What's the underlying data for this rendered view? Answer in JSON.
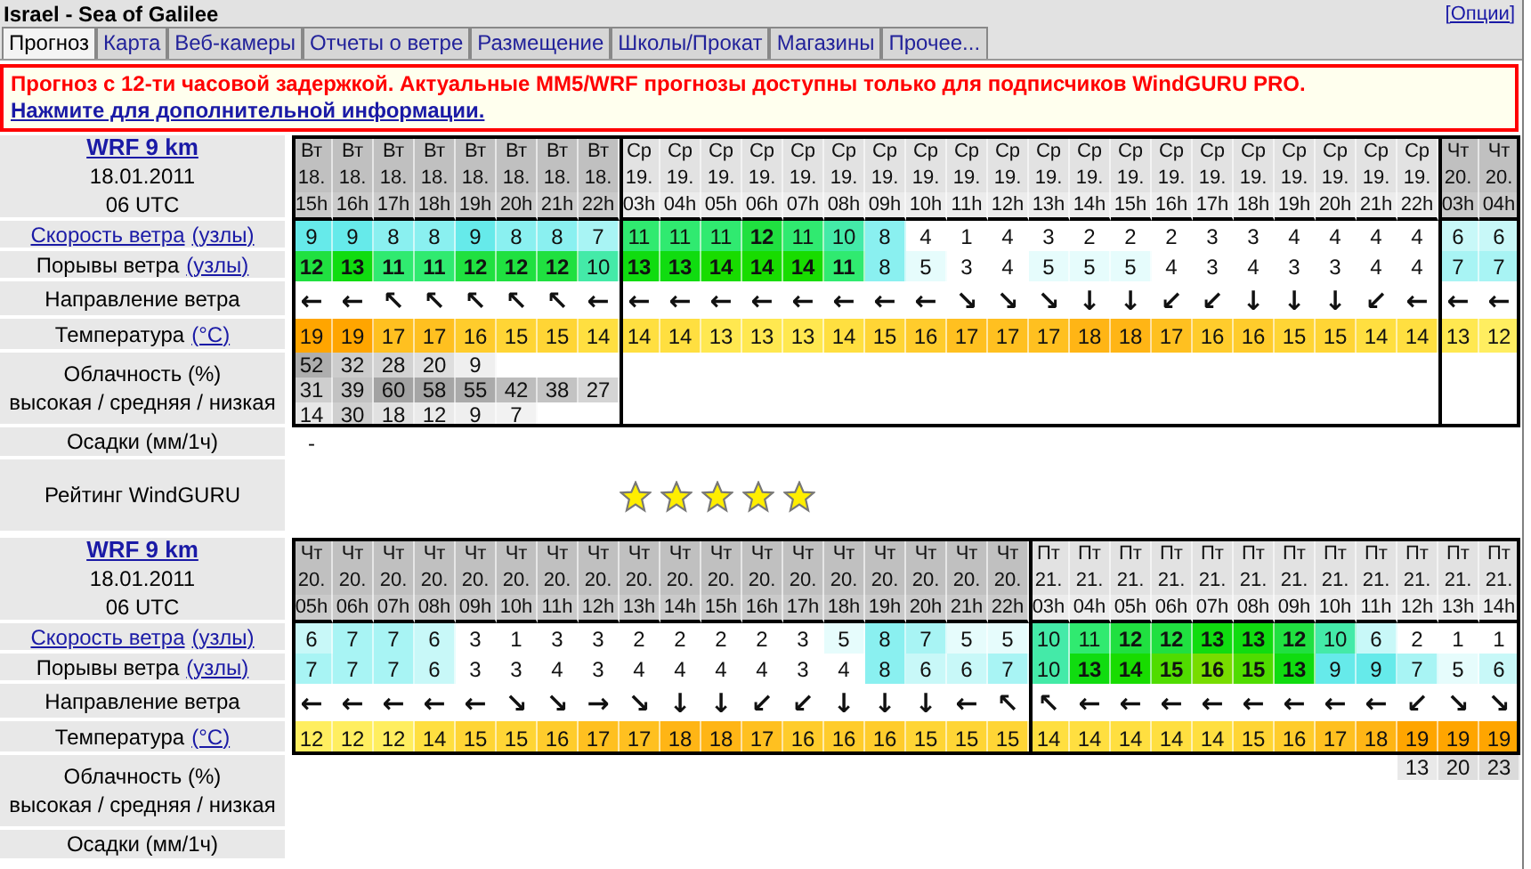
{
  "window": {
    "title": "Israel - Sea of Galilee",
    "options_link": "[Опции]"
  },
  "tabs": [
    {
      "label": "Прогноз",
      "selected": true
    },
    {
      "label": "Карта",
      "selected": false
    },
    {
      "label": "Веб-камеры",
      "selected": false
    },
    {
      "label": "Отчеты о ветре",
      "selected": false
    },
    {
      "label": "Размещение",
      "selected": false
    },
    {
      "label": "Школы/Прокат",
      "selected": false
    },
    {
      "label": "Магазины",
      "selected": false
    },
    {
      "label": "Прочее...",
      "selected": false
    }
  ],
  "notice": {
    "text": "Прогноз с 12-ти часовой задержкой. Актуальные MM5/WRF прогнозы доступны только для подписчиков WindGURU PRO.",
    "link": "Нажмите для дополнительной информации."
  },
  "forecasts": [
    {
      "model": "WRF 9 km",
      "date": "18.01.2011",
      "time": "06 UTC",
      "clouds_boxed": true,
      "labels": {
        "wind": "Скорость ветра",
        "wind_unit": "(узлы)",
        "gust": "Порывы ветра",
        "gust_unit": "(узлы)",
        "direction": "Направление ветра",
        "temp": "Температура",
        "temp_unit": "(°C)",
        "cloud": "Облачность (%)",
        "cloud_layers": "высокая / средняя / низкая",
        "precip": "Осадки (мм/1ч)",
        "rating": "Рейтинг WindGURU"
      },
      "days": [
        {
          "columns": [
            {
              "day": "Вт",
              "date": "18.",
              "hour": "15h",
              "wind": "9",
              "gust": "12",
              "dir": "←",
              "temp": "19",
              "cloud": {
                "high": "52",
                "mid": "31",
                "low": "14"
              }
            },
            {
              "day": "Вт",
              "date": "18.",
              "hour": "16h",
              "wind": "9",
              "gust": "13",
              "dir": "←",
              "temp": "19",
              "cloud": {
                "high": "32",
                "mid": "39",
                "low": "30"
              }
            },
            {
              "day": "Вт",
              "date": "18.",
              "hour": "17h",
              "wind": "8",
              "gust": "11",
              "dir": "↖",
              "temp": "17",
              "cloud": {
                "high": "28",
                "mid": "60",
                "low": "18"
              }
            },
            {
              "day": "Вт",
              "date": "18.",
              "hour": "18h",
              "wind": "8",
              "gust": "11",
              "dir": "↖",
              "temp": "17",
              "cloud": {
                "high": "20",
                "mid": "58",
                "low": "12"
              }
            },
            {
              "day": "Вт",
              "date": "18.",
              "hour": "19h",
              "wind": "9",
              "gust": "12",
              "dir": "↖",
              "temp": "16",
              "cloud": {
                "high": "9",
                "mid": "55",
                "low": "9"
              }
            },
            {
              "day": "Вт",
              "date": "18.",
              "hour": "20h",
              "wind": "8",
              "gust": "12",
              "dir": "↖",
              "temp": "15",
              "cloud": {
                "mid": "42",
                "low": "7"
              }
            },
            {
              "day": "Вт",
              "date": "18.",
              "hour": "21h",
              "wind": "8",
              "gust": "12",
              "dir": "↖",
              "temp": "15",
              "cloud": {
                "mid": "38"
              }
            },
            {
              "day": "Вт",
              "date": "18.",
              "hour": "22h",
              "wind": "7",
              "gust": "10",
              "dir": "←",
              "temp": "14",
              "cloud": {
                "mid": "27"
              }
            }
          ]
        },
        {
          "columns": [
            {
              "day": "Ср",
              "date": "19.",
              "hour": "03h",
              "wind": "11",
              "gust": "13",
              "dir": "←",
              "temp": "14"
            },
            {
              "day": "Ср",
              "date": "19.",
              "hour": "04h",
              "wind": "11",
              "gust": "13",
              "dir": "←",
              "temp": "14"
            },
            {
              "day": "Ср",
              "date": "19.",
              "hour": "05h",
              "wind": "11",
              "gust": "14",
              "dir": "←",
              "temp": "13"
            },
            {
              "day": "Ср",
              "date": "19.",
              "hour": "06h",
              "wind": "12",
              "gust": "14",
              "dir": "←",
              "temp": "13"
            },
            {
              "day": "Ср",
              "date": "19.",
              "hour": "07h",
              "wind": "11",
              "gust": "14",
              "dir": "←",
              "temp": "13"
            },
            {
              "day": "Ср",
              "date": "19.",
              "hour": "08h",
              "wind": "10",
              "gust": "11",
              "dir": "←",
              "temp": "14"
            },
            {
              "day": "Ср",
              "date": "19.",
              "hour": "09h",
              "wind": "8",
              "gust": "8",
              "dir": "←",
              "temp": "15"
            },
            {
              "day": "Ср",
              "date": "19.",
              "hour": "10h",
              "wind": "4",
              "gust": "5",
              "dir": "←",
              "temp": "16"
            },
            {
              "day": "Ср",
              "date": "19.",
              "hour": "11h",
              "wind": "1",
              "gust": "3",
              "dir": "↘",
              "temp": "17"
            },
            {
              "day": "Ср",
              "date": "19.",
              "hour": "12h",
              "wind": "4",
              "gust": "4",
              "dir": "↘",
              "temp": "17"
            },
            {
              "day": "Ср",
              "date": "19.",
              "hour": "13h",
              "wind": "3",
              "gust": "5",
              "dir": "↘",
              "temp": "17"
            },
            {
              "day": "Ср",
              "date": "19.",
              "hour": "14h",
              "wind": "2",
              "gust": "5",
              "dir": "↓",
              "temp": "18"
            },
            {
              "day": "Ср",
              "date": "19.",
              "hour": "15h",
              "wind": "2",
              "gust": "5",
              "dir": "↓",
              "temp": "18"
            },
            {
              "day": "Ср",
              "date": "19.",
              "hour": "16h",
              "wind": "2",
              "gust": "4",
              "dir": "↙",
              "temp": "17"
            },
            {
              "day": "Ср",
              "date": "19.",
              "hour": "17h",
              "wind": "3",
              "gust": "3",
              "dir": "↙",
              "temp": "16"
            },
            {
              "day": "Ср",
              "date": "19.",
              "hour": "18h",
              "wind": "3",
              "gust": "4",
              "dir": "↓",
              "temp": "16"
            },
            {
              "day": "Ср",
              "date": "19.",
              "hour": "19h",
              "wind": "4",
              "gust": "3",
              "dir": "↓",
              "temp": "15"
            },
            {
              "day": "Ср",
              "date": "19.",
              "hour": "20h",
              "wind": "4",
              "gust": "3",
              "dir": "↓",
              "temp": "15"
            },
            {
              "day": "Ср",
              "date": "19.",
              "hour": "21h",
              "wind": "4",
              "gust": "4",
              "dir": "↙",
              "temp": "14"
            },
            {
              "day": "Ср",
              "date": "19.",
              "hour": "22h",
              "wind": "4",
              "gust": "4",
              "dir": "←",
              "temp": "14"
            }
          ]
        },
        {
          "columns": [
            {
              "day": "Чт",
              "date": "20.",
              "hour": "03h",
              "wind": "6",
              "gust": "7",
              "dir": "←",
              "temp": "13"
            },
            {
              "day": "Чт",
              "date": "20.",
              "hour": "04h",
              "wind": "6",
              "gust": "7",
              "dir": "←",
              "temp": "12"
            }
          ]
        }
      ],
      "precip": [
        "-"
      ],
      "rating": {
        "stars": 5
      }
    },
    {
      "model": "WRF 9 km",
      "date": "18.01.2011",
      "time": "06 UTC",
      "clouds_boxed": false,
      "labels": {
        "wind": "Скорость ветра",
        "wind_unit": "(узлы)",
        "gust": "Порывы ветра",
        "gust_unit": "(узлы)",
        "direction": "Направление ветра",
        "temp": "Температура",
        "temp_unit": "(°C)",
        "cloud": "Облачность (%)",
        "cloud_layers": "высокая / средняя / низкая",
        "precip": "Осадки (мм/1ч)"
      },
      "days": [
        {
          "columns": [
            {
              "day": "Чт",
              "date": "20.",
              "hour": "05h",
              "wind": "6",
              "gust": "7",
              "dir": "←",
              "temp": "12"
            },
            {
              "day": "Чт",
              "date": "20.",
              "hour": "06h",
              "wind": "7",
              "gust": "7",
              "dir": "←",
              "temp": "12"
            },
            {
              "day": "Чт",
              "date": "20.",
              "hour": "07h",
              "wind": "7",
              "gust": "7",
              "dir": "←",
              "temp": "12"
            },
            {
              "day": "Чт",
              "date": "20.",
              "hour": "08h",
              "wind": "6",
              "gust": "6",
              "dir": "←",
              "temp": "14"
            },
            {
              "day": "Чт",
              "date": "20.",
              "hour": "09h",
              "wind": "3",
              "gust": "3",
              "dir": "←",
              "temp": "15"
            },
            {
              "day": "Чт",
              "date": "20.",
              "hour": "10h",
              "wind": "1",
              "gust": "3",
              "dir": "↘",
              "temp": "15"
            },
            {
              "day": "Чт",
              "date": "20.",
              "hour": "11h",
              "wind": "3",
              "gust": "4",
              "dir": "↘",
              "temp": "16"
            },
            {
              "day": "Чт",
              "date": "20.",
              "hour": "12h",
              "wind": "3",
              "gust": "3",
              "dir": "→",
              "temp": "17"
            },
            {
              "day": "Чт",
              "date": "20.",
              "hour": "13h",
              "wind": "2",
              "gust": "4",
              "dir": "↘",
              "temp": "17"
            },
            {
              "day": "Чт",
              "date": "20.",
              "hour": "14h",
              "wind": "2",
              "gust": "4",
              "dir": "↓",
              "temp": "18"
            },
            {
              "day": "Чт",
              "date": "20.",
              "hour": "15h",
              "wind": "2",
              "gust": "4",
              "dir": "↓",
              "temp": "18"
            },
            {
              "day": "Чт",
              "date": "20.",
              "hour": "16h",
              "wind": "2",
              "gust": "4",
              "dir": "↙",
              "temp": "17"
            },
            {
              "day": "Чт",
              "date": "20.",
              "hour": "17h",
              "wind": "3",
              "gust": "3",
              "dir": "↙",
              "temp": "16"
            },
            {
              "day": "Чт",
              "date": "20.",
              "hour": "18h",
              "wind": "5",
              "gust": "4",
              "dir": "↓",
              "temp": "16"
            },
            {
              "day": "Чт",
              "date": "20.",
              "hour": "19h",
              "wind": "8",
              "gust": "8",
              "dir": "↓",
              "temp": "16"
            },
            {
              "day": "Чт",
              "date": "20.",
              "hour": "20h",
              "wind": "7",
              "gust": "6",
              "dir": "↓",
              "temp": "15"
            },
            {
              "day": "Чт",
              "date": "20.",
              "hour": "21h",
              "wind": "5",
              "gust": "6",
              "dir": "←",
              "temp": "15"
            },
            {
              "day": "Чт",
              "date": "20.",
              "hour": "22h",
              "wind": "5",
              "gust": "7",
              "dir": "↖",
              "temp": "15"
            }
          ]
        },
        {
          "columns": [
            {
              "day": "Пт",
              "date": "21.",
              "hour": "03h",
              "wind": "10",
              "gust": "10",
              "dir": "↖",
              "temp": "14"
            },
            {
              "day": "Пт",
              "date": "21.",
              "hour": "04h",
              "wind": "11",
              "gust": "13",
              "dir": "←",
              "temp": "14"
            },
            {
              "day": "Пт",
              "date": "21.",
              "hour": "05h",
              "wind": "12",
              "gust": "14",
              "dir": "←",
              "temp": "14"
            },
            {
              "day": "Пт",
              "date": "21.",
              "hour": "06h",
              "wind": "12",
              "gust": "15",
              "dir": "←",
              "temp": "14"
            },
            {
              "day": "Пт",
              "date": "21.",
              "hour": "07h",
              "wind": "13",
              "gust": "16",
              "dir": "←",
              "temp": "14"
            },
            {
              "day": "Пт",
              "date": "21.",
              "hour": "08h",
              "wind": "13",
              "gust": "15",
              "dir": "←",
              "temp": "15"
            },
            {
              "day": "Пт",
              "date": "21.",
              "hour": "09h",
              "wind": "12",
              "gust": "13",
              "dir": "←",
              "temp": "16"
            },
            {
              "day": "Пт",
              "date": "21.",
              "hour": "10h",
              "wind": "10",
              "gust": "9",
              "dir": "←",
              "temp": "17"
            },
            {
              "day": "Пт",
              "date": "21.",
              "hour": "11h",
              "wind": "6",
              "gust": "9",
              "dir": "←",
              "temp": "18"
            },
            {
              "day": "Пт",
              "date": "21.",
              "hour": "12h",
              "wind": "2",
              "gust": "7",
              "dir": "↙",
              "temp": "19",
              "cloud": {
                "high": "13"
              }
            },
            {
              "day": "Пт",
              "date": "21.",
              "hour": "13h",
              "wind": "1",
              "gust": "5",
              "dir": "↘",
              "temp": "19",
              "cloud": {
                "high": "20"
              }
            },
            {
              "day": "Пт",
              "date": "21.",
              "hour": "14h",
              "wind": "1",
              "gust": "6",
              "dir": "↘",
              "temp": "19",
              "cloud": {
                "high": "23"
              }
            }
          ]
        }
      ]
    }
  ]
}
